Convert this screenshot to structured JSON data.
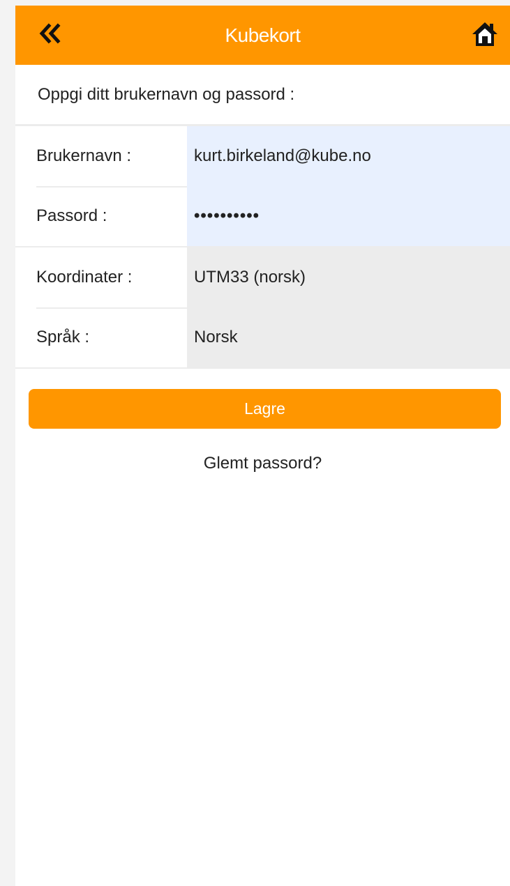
{
  "header": {
    "title": "Kubekort",
    "back_icon": "double-chevron-left-icon",
    "home_icon": "home-icon",
    "color": "#ff9600"
  },
  "intro_text": "Oppgi ditt brukernavn og passord :",
  "form": {
    "username": {
      "label": "Brukernavn :",
      "value": "kurt.birkeland@kube.no"
    },
    "password": {
      "label": "Passord :",
      "value": "••••••••••"
    },
    "coordinates": {
      "label": "Koordinater :",
      "value": "UTM33 (norsk)"
    },
    "language": {
      "label": "Språk :",
      "value": "Norsk"
    }
  },
  "save_button": {
    "label": "Lagre"
  },
  "forgot_password": {
    "label": "Glemt passord?"
  },
  "colors": {
    "accent": "#ff9600",
    "input_bg": "#e8f0fe",
    "select_bg": "#ececec"
  }
}
